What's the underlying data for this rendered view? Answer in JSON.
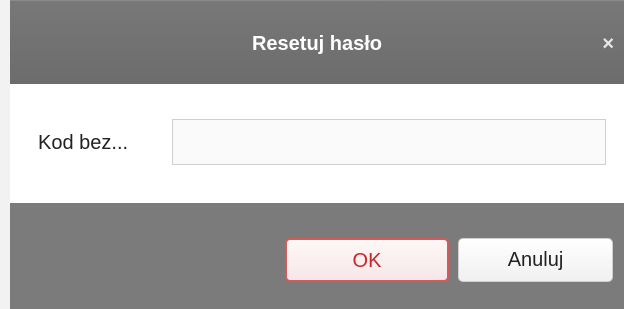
{
  "dialog": {
    "title": "Resetuj hasło",
    "close_label": "×"
  },
  "form": {
    "field_label": "Kod bez...",
    "field_value": "",
    "field_placeholder": ""
  },
  "footer": {
    "ok_label": "OK",
    "cancel_label": "Anuluj"
  },
  "colors": {
    "titlebar": "#747474",
    "ok_border": "#d55a5a",
    "ok_text": "#c62828"
  }
}
